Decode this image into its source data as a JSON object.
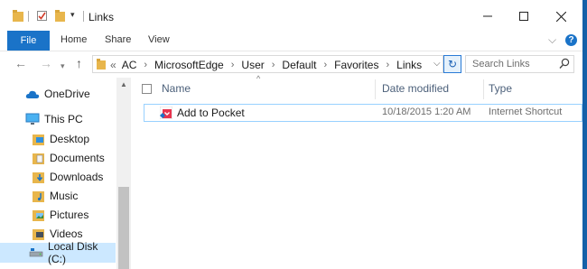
{
  "window": {
    "title": "Links"
  },
  "ribbon": {
    "tabs": [
      "File",
      "Home",
      "Share",
      "View"
    ],
    "help": "?"
  },
  "address": {
    "overflow": "«",
    "crumbs": [
      "AC",
      "MicrosoftEdge",
      "User",
      "Default",
      "Favorites",
      "Links"
    ]
  },
  "search": {
    "placeholder": "Search Links"
  },
  "sidebar": {
    "items": [
      {
        "label": "OneDrive",
        "icon": "cloud-icon"
      },
      {
        "label": "This PC",
        "icon": "computer-icon"
      },
      {
        "label": "Desktop",
        "icon": "desktop-folder-icon"
      },
      {
        "label": "Documents",
        "icon": "documents-folder-icon"
      },
      {
        "label": "Downloads",
        "icon": "downloads-folder-icon"
      },
      {
        "label": "Music",
        "icon": "music-folder-icon"
      },
      {
        "label": "Pictures",
        "icon": "pictures-folder-icon"
      },
      {
        "label": "Videos",
        "icon": "videos-folder-icon"
      },
      {
        "label": "Local Disk (C:)",
        "icon": "drive-icon",
        "selected": true
      }
    ]
  },
  "columns": {
    "name": "Name",
    "date": "Date modified",
    "type": "Type"
  },
  "files": [
    {
      "name": "Add to Pocket",
      "date": "10/18/2015 1:20 AM",
      "type": "Internet Shortcut",
      "icon": "pocket-icon"
    }
  ],
  "colors": {
    "accent": "#1a73c8",
    "selection": "#cce8ff",
    "desktop_bg": "#1560a8",
    "pocket": "#e8344e"
  }
}
